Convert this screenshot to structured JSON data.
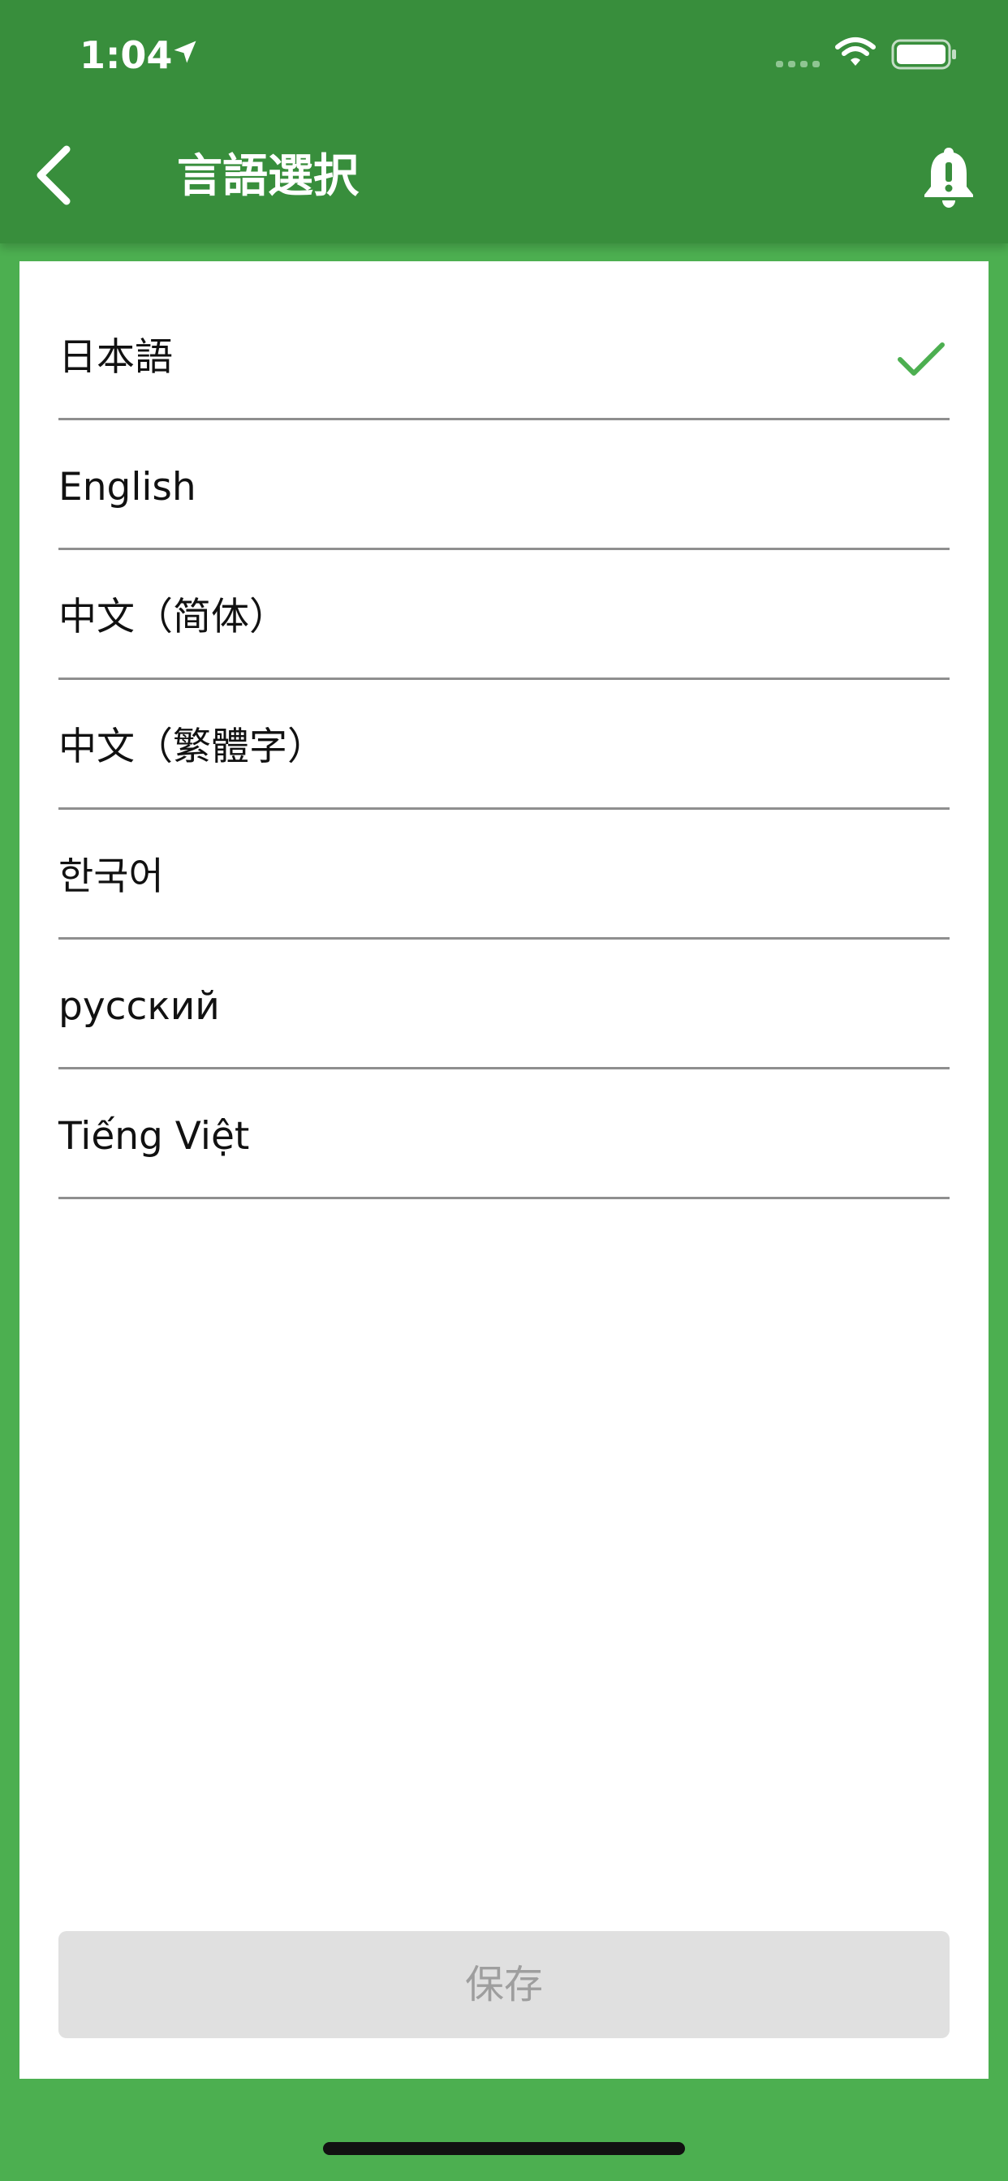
{
  "status_bar": {
    "time": "1:04",
    "icons": [
      "location-arrow-icon",
      "signal-icon",
      "wifi-icon",
      "battery-icon"
    ]
  },
  "header": {
    "title": "言語選択",
    "back_icon": "chevron-left-icon",
    "action_icon": "bell-alert-icon"
  },
  "languages": {
    "selected_index": 0,
    "items": [
      {
        "label": "日本語",
        "selected": true
      },
      {
        "label": "English",
        "selected": false
      },
      {
        "label": "中文（简体）",
        "selected": false
      },
      {
        "label": "中文（繁體字）",
        "selected": false
      },
      {
        "label": "한국어",
        "selected": false
      },
      {
        "label": "русский",
        "selected": false
      },
      {
        "label": "Tiếng Việt",
        "selected": false
      }
    ]
  },
  "footer": {
    "save_label": "保存",
    "save_disabled": true
  },
  "colors": {
    "header_bg": "#388e3c",
    "page_bg": "#4caf50",
    "check": "#4caf50",
    "divider": "#8f8f8f",
    "button_disabled_bg": "#e0e0e0",
    "button_disabled_text": "#9e9e9e"
  }
}
